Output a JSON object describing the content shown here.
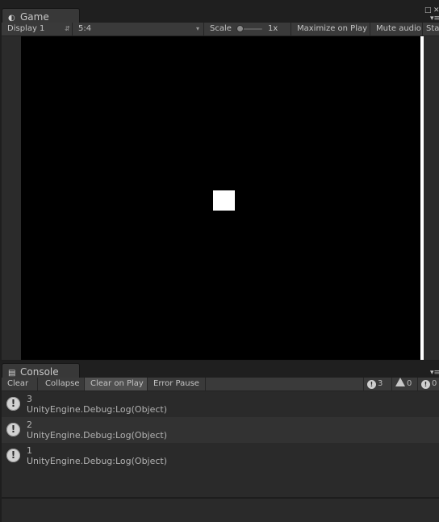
{
  "game_window": {
    "tab_label": "Game",
    "toolbar": {
      "display": "Display 1",
      "aspect": "5:4",
      "scale_label": "Scale",
      "scale_value": "1x",
      "scale_level": 0.0,
      "maximize_on_play": "Maximize on Play",
      "mute_audio": "Mute audio",
      "stats": "Sta"
    }
  },
  "console_window": {
    "tab_label": "Console",
    "toolbar": {
      "clear": "Clear",
      "collapse": "Collapse",
      "clear_on_play": "Clear on Play",
      "error_pause": "Error Pause",
      "log_count": "3",
      "warning_count": "0",
      "error_count": "0"
    },
    "entries": [
      {
        "message": "3",
        "source": "UnityEngine.Debug:Log(Object)"
      },
      {
        "message": "2",
        "source": "UnityEngine.Debug:Log(Object)"
      },
      {
        "message": "1",
        "source": "UnityEngine.Debug:Log(Object)"
      }
    ]
  },
  "icons": {
    "game_tab": "unity-logo-icon",
    "console_tab": "console-icon",
    "log_entry": "info-icon",
    "warning": "warning-icon",
    "error": "error-icon"
  },
  "colors": {
    "panel_bg": "#3a3a3a",
    "game_bg": "#000000",
    "text": "#c4c4c4",
    "active_toggle": "#505050"
  }
}
